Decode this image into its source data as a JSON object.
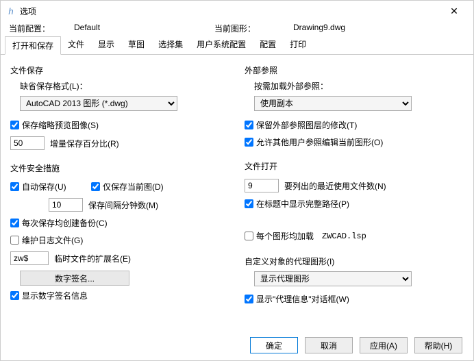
{
  "window": {
    "title": "选项"
  },
  "info": {
    "profile_label": "当前配置：",
    "profile_value": "Default",
    "drawing_label": "当前图形：",
    "drawing_value": "Drawing9.dwg"
  },
  "tabs": [
    "打开和保存",
    "文件",
    "显示",
    "草图",
    "选择集",
    "用户系统配置",
    "配置",
    "打印"
  ],
  "left": {
    "file_save_title": "文件保存",
    "default_format_label": "缺省保存格式(L)：",
    "format_select": "AutoCAD 2013 图形 (*.dwg)",
    "save_thumbnail": "保存缩略预览图像(S)",
    "incremental_value": "50",
    "incremental_label": "增量保存百分比(R)",
    "safety_title": "文件安全措施",
    "auto_save": "自动保存(U)",
    "save_current_only": "仅保存当前图(D)",
    "minutes_value": "10",
    "minutes_label": "保存间隔分钟数(M)",
    "create_backup": "每次保存均创建备份(C)",
    "maintain_log": "维护日志文件(G)",
    "temp_ext_value": "zw$",
    "temp_ext_label": "临时文件的扩展名(E)",
    "digital_sig_btn": "数字签名...",
    "show_sig_info": "显示数字签名信息"
  },
  "right": {
    "xref_title": "外部参照",
    "xref_sub": "按需加载外部参照：",
    "xref_select": "使用副本",
    "keep_xref_layers": "保留外部参照图层的修改(T)",
    "allow_others_edit": "允许其他用户参照编辑当前图形(O)",
    "file_open_title": "文件打开",
    "recent_value": "9",
    "recent_label": "要列出的最近使用文件数(N)",
    "show_full_path": "在标题中显示完整路径(P)",
    "load_lsp": "每个图形均加载",
    "lsp_name": "ZWCAD.lsp",
    "proxy_title": "自定义对象的代理图形(I)",
    "proxy_select": "显示代理图形",
    "show_proxy_dialog": "显示\"代理信息\"对话框(W)"
  },
  "buttons": {
    "ok": "确定",
    "cancel": "取消",
    "apply": "应用(A)",
    "help": "帮助(H)"
  }
}
